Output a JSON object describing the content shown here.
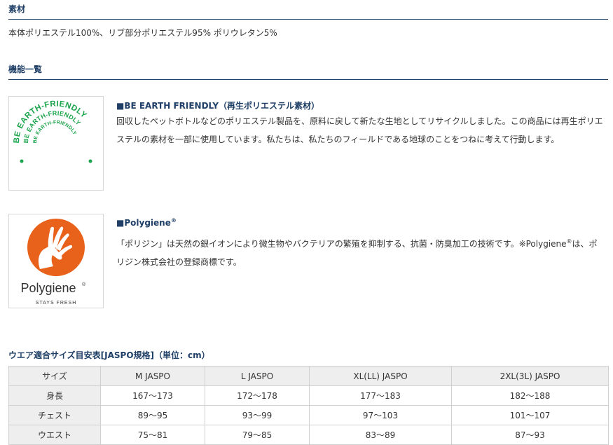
{
  "material": {
    "heading": "素材",
    "text": "本体ポリエステル100%、リブ部分ポリエステル95% ポリウレタン5%"
  },
  "functions": {
    "heading": "機能一覧",
    "items": [
      {
        "title": "■BE EARTH FRIENDLY（再生ポリエステル素材）",
        "body": "回収したペットボトルなどのポリエステル製品を、原料に戻して新たな生地としてリサイクルしました。この商品には再生ポリエステルの素材を一部に使用しています。私たちは、私たちのフィールドである地球のことをつねに考えて行動します。",
        "logo_text": "BE EARTH-FRIENDLY",
        "logo_color": "#1aa34a"
      },
      {
        "title": "■Polygiene",
        "title_mark": "®",
        "body_before": "「ポリジン」は天然の銀イオンにより微生物やバクテリアの繁殖を抑制する、抗菌・防臭加工の技術です。※Polygiene",
        "body_mark": "®",
        "body_after": "は、ポリジン株式会社の登録商標です。",
        "logo_name": "Polygiene",
        "logo_mark": "®",
        "logo_tagline": "STAYS FRESH",
        "logo_color": "#e8621c"
      }
    ]
  },
  "size_table": {
    "caption": "ウエア適合サイズ目安表[JASPO規格]（単位：cm）",
    "header": [
      "サイズ",
      "M JASPO",
      "L JASPO",
      "XL(LL) JASPO",
      "2XL(3L) JASPO"
    ],
    "rows": [
      [
        "身長",
        "167〜173",
        "172〜178",
        "177〜183",
        "182〜188"
      ],
      [
        "チェスト",
        "89〜95",
        "93〜99",
        "97〜103",
        "101〜107"
      ],
      [
        "ウエスト",
        "75〜81",
        "79〜85",
        "83〜89",
        "87〜93"
      ]
    ]
  }
}
